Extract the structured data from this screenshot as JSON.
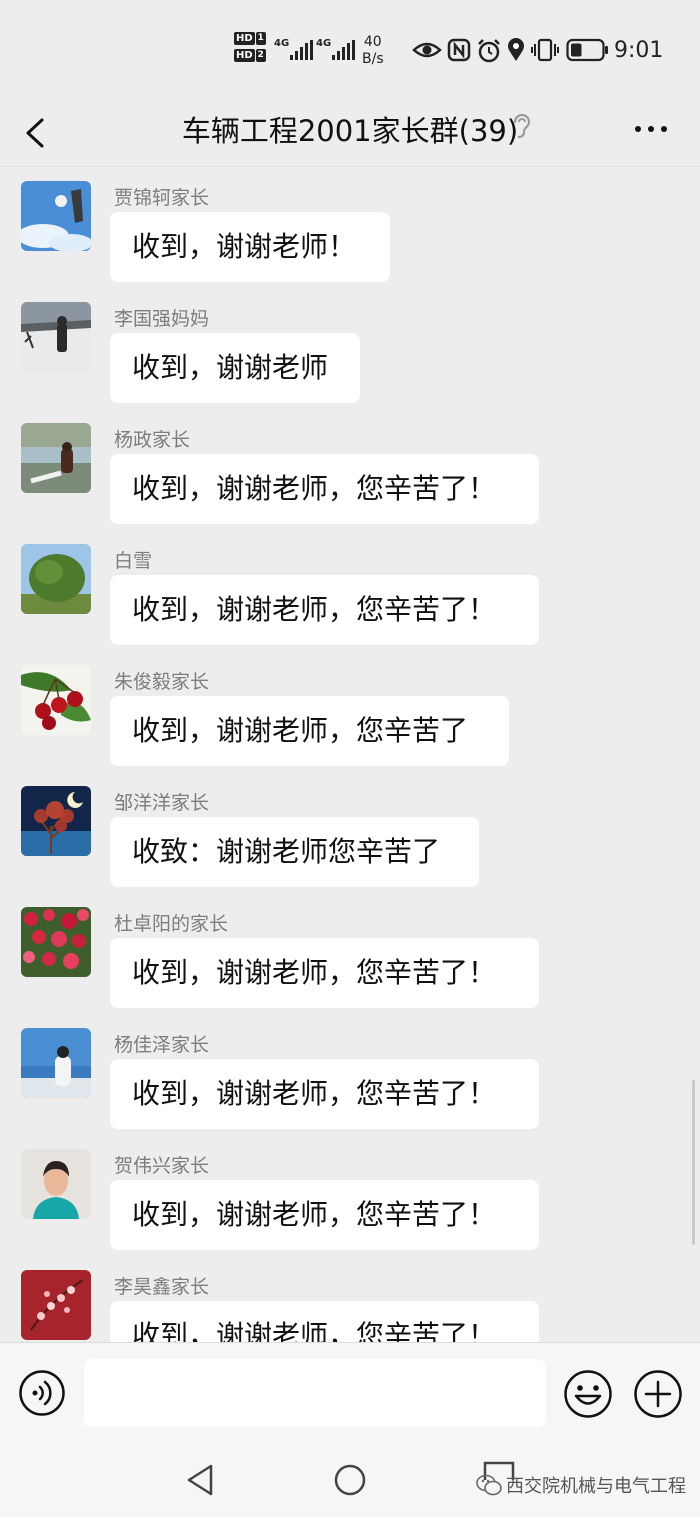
{
  "status_bar": {
    "sim1": "HD",
    "sim1_slot": "1",
    "sim2": "HD",
    "sim2_slot": "2",
    "network1": "4G",
    "network2": "4G",
    "speed_value": "40",
    "speed_unit": "B/s",
    "battery_level": 0.35,
    "time": "9:01",
    "icons": [
      "eye-icon",
      "nfc-icon",
      "alarm-icon",
      "location-icon",
      "vibrate-icon",
      "battery-icon"
    ]
  },
  "header": {
    "title": "车辆工程2001家长群(39)",
    "back_icon": "chevron-left-icon",
    "ear_icon": "earpiece-icon",
    "more_icon": "more-icon"
  },
  "messages": [
    {
      "sender": "贾锦轲家长",
      "text": "收到，谢谢老师！",
      "avatar": "sky-hand-photo"
    },
    {
      "sender": "李国强妈妈",
      "text": "收到，谢谢老师",
      "avatar": "snow-person-photo"
    },
    {
      "sender": "杨政家长",
      "text": "收到，谢谢老师，您辛苦了！",
      "avatar": "lakeside-photo"
    },
    {
      "sender": "白雪",
      "text": "收到，谢谢老师，您辛苦了！",
      "avatar": "tree-photo"
    },
    {
      "sender": "朱俊毅家长",
      "text": "收到，谢谢老师，您辛苦了",
      "avatar": "cherries-photo"
    },
    {
      "sender": "邹洋洋家长",
      "text": "收致：谢谢老师您辛苦了",
      "avatar": "moon-tree-photo"
    },
    {
      "sender": "杜卓阳的家长",
      "text": "收到，谢谢老师，您辛苦了！",
      "avatar": "red-flowers-photo"
    },
    {
      "sender": "杨佳泽家长",
      "text": "收到，谢谢老师，您辛苦了！",
      "avatar": "sea-person-photo"
    },
    {
      "sender": "贺伟兴家长",
      "text": "收到，谢谢老师，您辛苦了！",
      "avatar": "selfie-photo"
    },
    {
      "sender": "李昊鑫家长",
      "text": "收到，谢谢老师，您辛苦了！",
      "avatar": "blossom-photo"
    }
  ],
  "input_bar": {
    "voice_icon": "voice-icon",
    "value": "",
    "emoji_icon": "emoji-icon",
    "plus_icon": "plus-icon"
  },
  "nav_bar": {
    "icons": [
      "nav-back-icon",
      "nav-home-icon",
      "nav-recent-icon"
    ],
    "watermark": "西交院机械与电气工程"
  },
  "colors": {
    "background": "#ededed",
    "bubble": "#ffffff",
    "sender_name": "#7d7d7d",
    "text": "#111111"
  }
}
